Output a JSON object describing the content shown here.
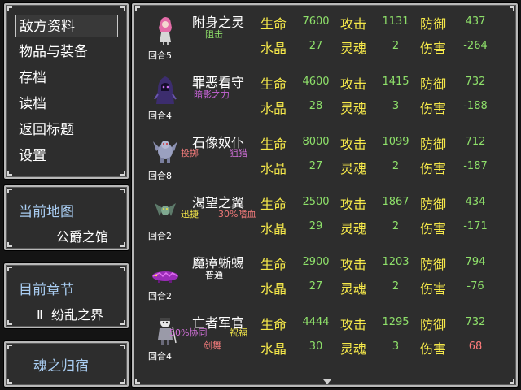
{
  "menu": {
    "items": [
      "敌方资料",
      "物品与装备",
      "存档",
      "读档",
      "返回标题",
      "设置"
    ],
    "selected_index": 0
  },
  "map": {
    "title": "当前地图",
    "value": "公爵之馆"
  },
  "chapter": {
    "title": "目前章节",
    "value": "Ⅱ  纷乱之界"
  },
  "soul_home": {
    "label": "魂之归宿"
  },
  "stat_labels": {
    "hp": "生命",
    "atk": "攻击",
    "def": "防御",
    "crystal": "水晶",
    "soul": "灵魂",
    "dmg": "伤害"
  },
  "colors": {
    "label": "#f6e94a",
    "value": "#8ee06a",
    "negative_damage": "#8ee06a",
    "positive_damage": "#ff7b7b",
    "section_title": "#a9cdf2"
  },
  "enemies": [
    {
      "name": "附身之灵",
      "turn": "回合5",
      "sprite": "ghost-girl-icon",
      "skills": [
        {
          "text": "阻击",
          "color": "#8ee06a"
        }
      ],
      "hp": "7600",
      "atk": "1131",
      "def": "437",
      "crystal": "27",
      "soul": "2",
      "dmg": "-264",
      "dmg_color": "#8ee06a"
    },
    {
      "name": "罪恶看守",
      "turn": "回合4",
      "sprite": "hooded-wraith-icon",
      "skills": [
        {
          "text": "暗影之力",
          "color": "#c864d8"
        }
      ],
      "hp": "4600",
      "atk": "1415",
      "def": "732",
      "crystal": "28",
      "soul": "3",
      "dmg": "-188",
      "dmg_color": "#8ee06a"
    },
    {
      "name": "石像奴仆",
      "turn": "回合8",
      "sprite": "gargoyle-icon",
      "skills": [
        {
          "text": "投掷",
          "color": "#f07a7a"
        },
        {
          "text": "狙猎",
          "color": "#d070d8"
        }
      ],
      "hp": "8000",
      "atk": "1099",
      "def": "712",
      "crystal": "27",
      "soul": "2",
      "dmg": "-187",
      "dmg_color": "#8ee06a"
    },
    {
      "name": "渴望之翼",
      "turn": "回合2",
      "sprite": "winged-bat-icon",
      "skills": [
        {
          "text": "迅捷",
          "color": "#f6e94a"
        },
        {
          "text": "30%嗜血",
          "color": "#f07a7a"
        }
      ],
      "hp": "2500",
      "atk": "1867",
      "def": "434",
      "crystal": "29",
      "soul": "2",
      "dmg": "-171",
      "dmg_color": "#8ee06a"
    },
    {
      "name": "魔瘴蜥蜴",
      "turn": "回合2",
      "sprite": "lizard-icon",
      "skills": [
        {
          "text": "普通",
          "color": "#ffffff"
        }
      ],
      "hp": "2900",
      "atk": "1203",
      "def": "794",
      "crystal": "27",
      "soul": "2",
      "dmg": "-76",
      "dmg_color": "#8ee06a"
    },
    {
      "name": "亡者军官",
      "turn": "回合4",
      "sprite": "undead-officer-icon",
      "skills": [
        {
          "text": "50%协同",
          "color": "#d070d8"
        },
        {
          "text": "祝福",
          "color": "#f6e94a"
        },
        {
          "text": "剑舞",
          "color": "#f07a7a"
        }
      ],
      "hp": "4444",
      "atk": "1295",
      "def": "732",
      "crystal": "30",
      "soul": "3",
      "dmg": "68",
      "dmg_color": "#ff7b7b"
    }
  ]
}
